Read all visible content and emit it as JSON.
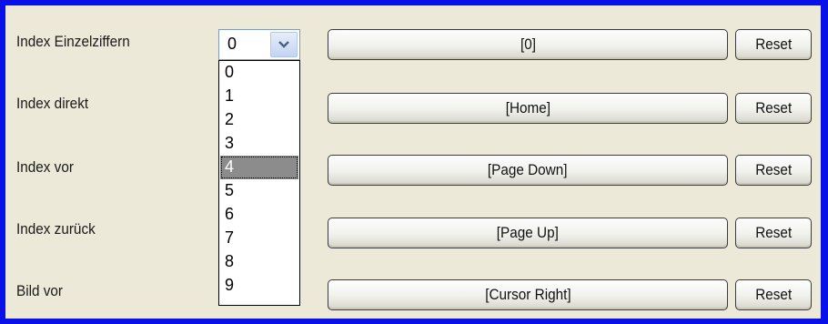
{
  "rows": [
    {
      "label": "Index Einzelziffern",
      "binding": "[0]",
      "reset_label": "Reset"
    },
    {
      "label": "Index direkt",
      "binding": "[Home]",
      "reset_label": "Reset"
    },
    {
      "label": "Index vor",
      "binding": "[Page Down]",
      "reset_label": "Reset"
    },
    {
      "label": "Index zurück",
      "binding": "[Page Up]",
      "reset_label": "Reset"
    },
    {
      "label": "Bild vor",
      "binding": "[Cursor Right]",
      "reset_label": "Reset"
    }
  ],
  "combo": {
    "value": "0",
    "options": [
      "0",
      "1",
      "2",
      "3",
      "4",
      "5",
      "6",
      "7",
      "8",
      "9"
    ],
    "highlighted": "4",
    "icon": "chevron-down-icon"
  },
  "colors": {
    "frame_border": "#0a10e8",
    "dialog_bg": "#ece9d8",
    "highlight": "#8c8c8c"
  }
}
